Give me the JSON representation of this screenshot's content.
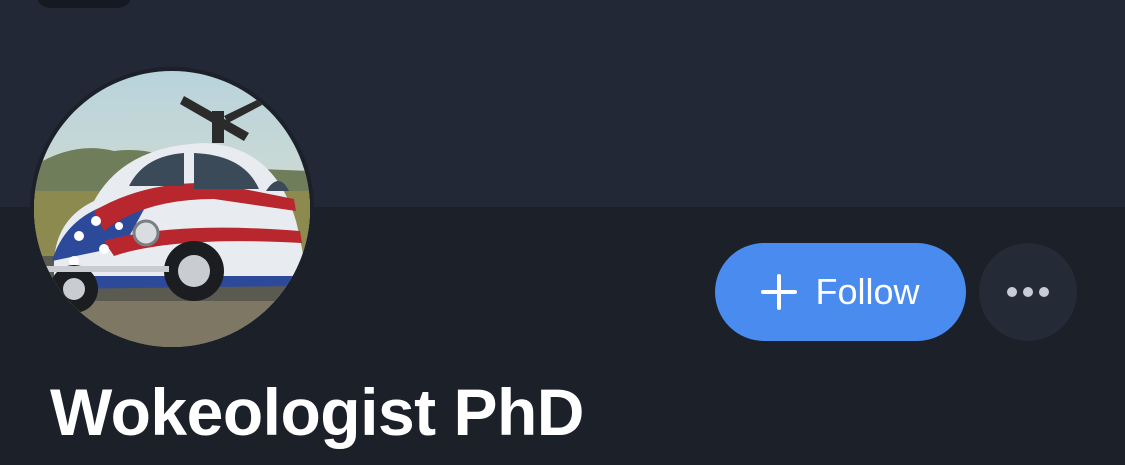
{
  "profile": {
    "display_name": "Wokeologist PhD",
    "avatar_description_icon": "avatar-image"
  },
  "actions": {
    "follow_label": "Follow",
    "follow_icon": "plus-icon",
    "more_icon": "more-horizontal-icon"
  },
  "colors": {
    "banner": "#222835",
    "background": "#1b2029",
    "follow_button": "#4a8bf0",
    "more_button": "#252b36",
    "text": "#ffffff"
  }
}
